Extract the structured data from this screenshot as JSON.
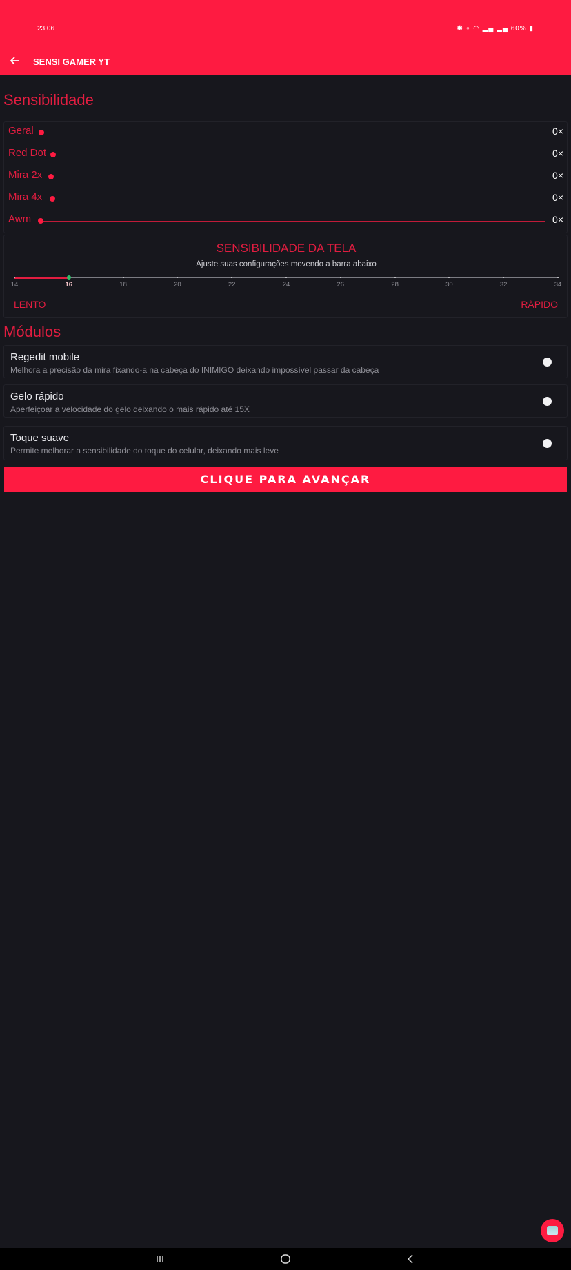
{
  "status_bar": {
    "time": "23:06",
    "icons": [
      "bluetooth-icon",
      "location-icon",
      "wifi-icon",
      "signal-icon",
      "signal-icon"
    ],
    "battery": "60%"
  },
  "appbar": {
    "title": "SENSI GAMER YT",
    "color": "#fe1b41"
  },
  "sensibilidade": {
    "title": "Sensibilidade",
    "rows": [
      {
        "label": "Geral",
        "value": "0×",
        "level": 0
      },
      {
        "label": "Red Dot",
        "value": "0×",
        "level": 0
      },
      {
        "label": "Mira 2x",
        "value": "0×",
        "level": 0
      },
      {
        "label": "Mira 4x",
        "value": "0×",
        "level": 0
      },
      {
        "label": "Awm",
        "value": "0×",
        "level": 0
      }
    ]
  },
  "tela": {
    "title": "SENSIBILIDADE DA TELA",
    "subtitle": "Ajuste suas configurações movendo a barra abaixo",
    "min": 14,
    "max": 34,
    "value": 16,
    "ticks": [
      "14",
      "16",
      "18",
      "20",
      "22",
      "24",
      "26",
      "28",
      "30",
      "32",
      "34"
    ],
    "left_label": "LENTO",
    "right_label": "RÁPIDO"
  },
  "modulos": {
    "title": "Módulos",
    "items": [
      {
        "title": "Regedit mobile",
        "desc": "Melhora a precisão da mira fixando-a na cabeça do INIMIGO deixando impossível passar da cabeça",
        "selected": false
      },
      {
        "title": "Gelo rápido",
        "desc": "Aperfeiçoar a velocidade do gelo deixando o mais rápido até 15X",
        "selected": false
      },
      {
        "title": "Toque suave",
        "desc": "Permite melhorar a sensibilidade do toque do celular, deixando mais leve",
        "selected": false
      }
    ]
  },
  "cta": {
    "label": "CLIQUE PARA AVANÇAR"
  },
  "colors": {
    "accent": "#fe1b41",
    "label_red": "#e11d40",
    "background": "#17171d",
    "thumb_green": "#2fbf6a"
  }
}
